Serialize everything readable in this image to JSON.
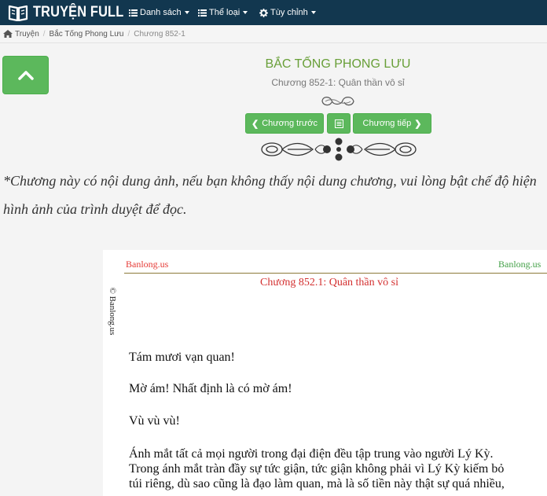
{
  "navbar": {
    "brand": "TRUYỆN FULL",
    "menu": [
      {
        "label": "Danh sách"
      },
      {
        "label": "Thể loại"
      },
      {
        "label": "Tùy chỉnh"
      }
    ]
  },
  "breadcrumb": {
    "home": "Truyện",
    "story": "Bắc Tống Phong Lưu",
    "chapter": "Chương 852-1"
  },
  "header": {
    "story_title": "Bắc Tống Phong Lưu",
    "chapter_title": "Chương 852-1: Quân thần vô sỉ"
  },
  "chapter_nav": {
    "prev": "Chương trước",
    "next": "Chương tiếp"
  },
  "notice": "*Chương này có nội dung ảnh, nếu bạn không thấy nội dung chương, vui lòng bật chế độ hiện hình ảnh của trình duyệt để đọc.",
  "chapter_image": {
    "watermark_left": "Banlong.us",
    "watermark_right": "Banlong.us",
    "side_watermark": "© Banlong.us",
    "heading": "Chương 852.1: Quân thần vô sỉ",
    "paragraphs": [
      "Tám mươi vạn quan!",
      "Mờ ám! Nhất định là có mờ ám!",
      "Vù vù vù!",
      "Ánh mắt tất cả mọi người trong đại điện đều tập trung vào người Lý Kỳ.\nTrong ánh mắt tràn đầy sự tức giận, tức giận không phải vì Lý Kỳ kiếm bỏ\ntúi riêng, dù sao cũng là đạo làm quan, mà là số tiền này thật sự quá nhiều,"
    ]
  },
  "colors": {
    "navbar_bg": "#12374f",
    "accent_green": "#5cb85c",
    "title_green": "#689f38",
    "watermark_red": "#e53935",
    "watermark_green": "#43a047"
  }
}
